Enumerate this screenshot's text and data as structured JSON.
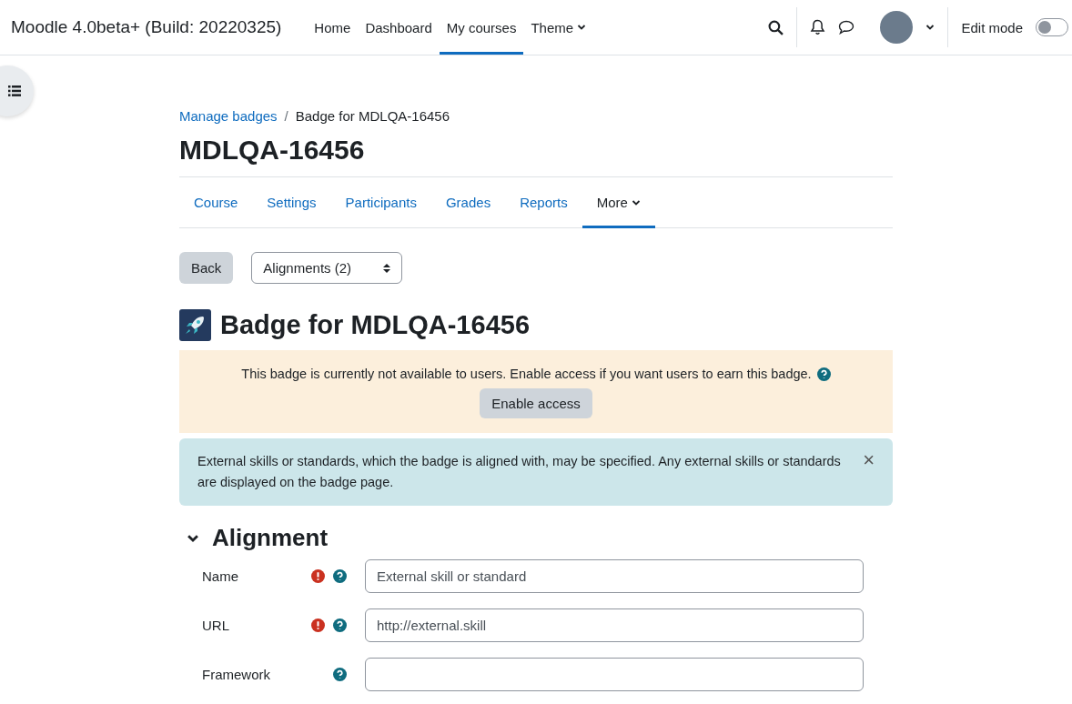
{
  "navbar": {
    "brand": "Moodle 4.0beta+ (Build: 20220325)",
    "items": [
      {
        "label": "Home",
        "selected": false,
        "dropdown": false
      },
      {
        "label": "Dashboard",
        "selected": false,
        "dropdown": false
      },
      {
        "label": "My courses",
        "selected": true,
        "dropdown": false
      },
      {
        "label": "Theme",
        "selected": false,
        "dropdown": true
      }
    ],
    "edit_mode": {
      "label": "Edit mode",
      "on": false
    }
  },
  "breadcrumb_separator": "/",
  "breadcrumb": [
    {
      "label": "Manage badges",
      "link": true
    },
    {
      "label": "Badge for MDLQA-16456",
      "link": false
    }
  ],
  "course_title": "MDLQA-16456",
  "tabs": [
    {
      "label": "Course",
      "selected": false,
      "dropdown": false
    },
    {
      "label": "Settings",
      "selected": false,
      "dropdown": false
    },
    {
      "label": "Participants",
      "selected": false,
      "dropdown": false
    },
    {
      "label": "Grades",
      "selected": false,
      "dropdown": false
    },
    {
      "label": "Reports",
      "selected": false,
      "dropdown": false
    },
    {
      "label": "More",
      "selected": true,
      "dropdown": true
    }
  ],
  "back_button": "Back",
  "select": {
    "value": "Alignments (2)"
  },
  "badge_title": "Badge for MDLQA-16456",
  "warning": {
    "text": "This badge is currently not available to users. Enable access if you want users to earn this badge.",
    "button": "Enable access"
  },
  "info": {
    "text": "External skills or standards, which the badge is aligned with, may be specified. Any external skills or standards are displayed on the badge page.",
    "close": "×"
  },
  "section": {
    "title": "Alignment",
    "expanded": true,
    "fields": [
      {
        "label": "Name",
        "required": true,
        "value": "External skill or standard"
      },
      {
        "label": "URL",
        "required": true,
        "value": "http://external.skill"
      },
      {
        "label": "Framework",
        "required": false
      }
    ]
  }
}
